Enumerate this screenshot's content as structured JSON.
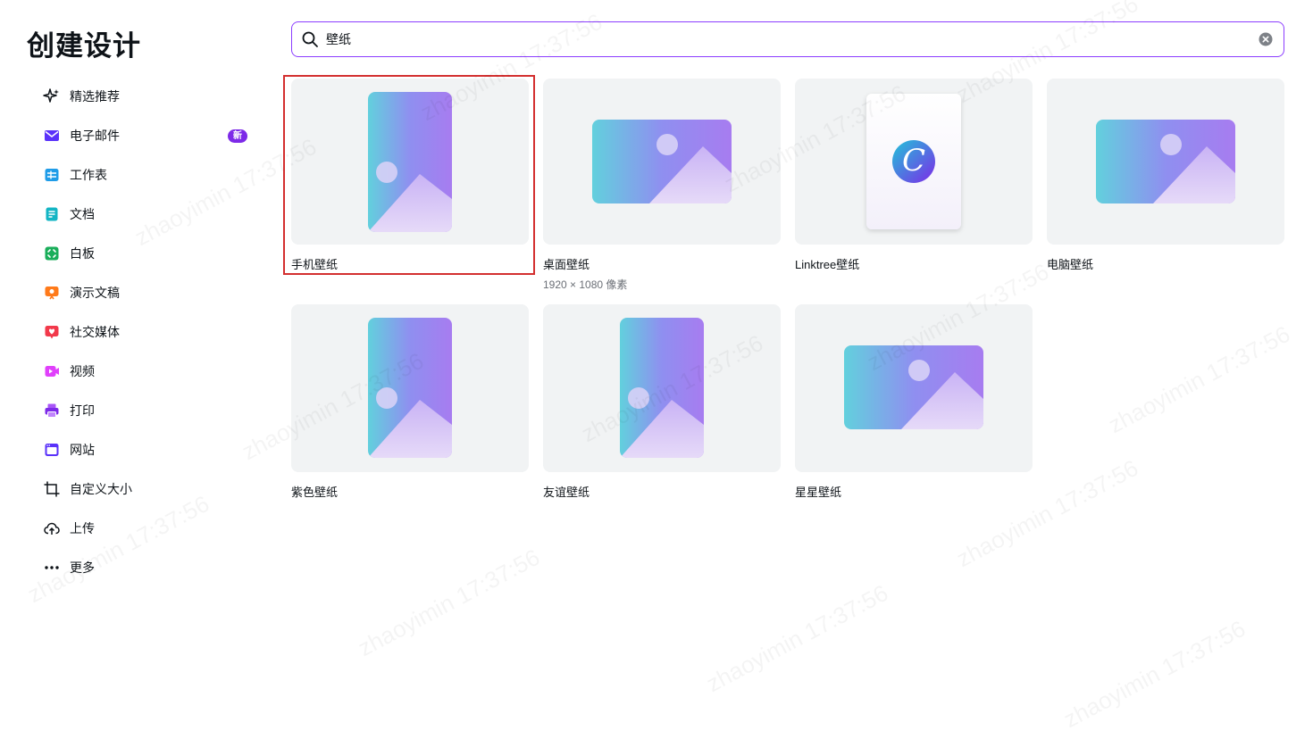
{
  "page": {
    "title": "创建设计"
  },
  "sidebar": {
    "items": [
      {
        "label": "精选推荐",
        "icon": "sparkle-icon"
      },
      {
        "label": "电子邮件",
        "icon": "mail-icon",
        "badge": "新"
      },
      {
        "label": "工作表",
        "icon": "sheet-icon"
      },
      {
        "label": "文档",
        "icon": "doc-icon"
      },
      {
        "label": "白板",
        "icon": "whiteboard-icon"
      },
      {
        "label": "演示文稿",
        "icon": "presentation-icon"
      },
      {
        "label": "社交媒体",
        "icon": "heart-icon"
      },
      {
        "label": "视频",
        "icon": "video-icon"
      },
      {
        "label": "打印",
        "icon": "printer-icon"
      },
      {
        "label": "网站",
        "icon": "website-icon"
      },
      {
        "label": "自定义大小",
        "icon": "custom-size-icon"
      },
      {
        "label": "上传",
        "icon": "cloud-upload-icon"
      },
      {
        "label": "更多",
        "icon": "more-icon"
      }
    ]
  },
  "search": {
    "value": "壁纸"
  },
  "results": [
    {
      "label": "手机壁纸",
      "sub": "",
      "thumb": "portrait",
      "selected": true
    },
    {
      "label": "桌面壁纸",
      "sub": "1920 × 1080 像素",
      "thumb": "landscape"
    },
    {
      "label": "Linktree壁纸",
      "sub": "",
      "thumb": "canva-doc"
    },
    {
      "label": "电脑壁纸",
      "sub": "",
      "thumb": "landscape"
    },
    {
      "label": "紫色壁纸",
      "sub": "",
      "thumb": "portrait"
    },
    {
      "label": "友谊壁纸",
      "sub": "",
      "thumb": "portrait"
    },
    {
      "label": "星星壁纸",
      "sub": "",
      "thumb": "landscape"
    }
  ],
  "watermark": {
    "text": "zhaoyimin 17:37:56"
  },
  "colors": {
    "accent": "#8b3dff",
    "badge": "#7d2ae8",
    "selection": "#d32f2f"
  }
}
